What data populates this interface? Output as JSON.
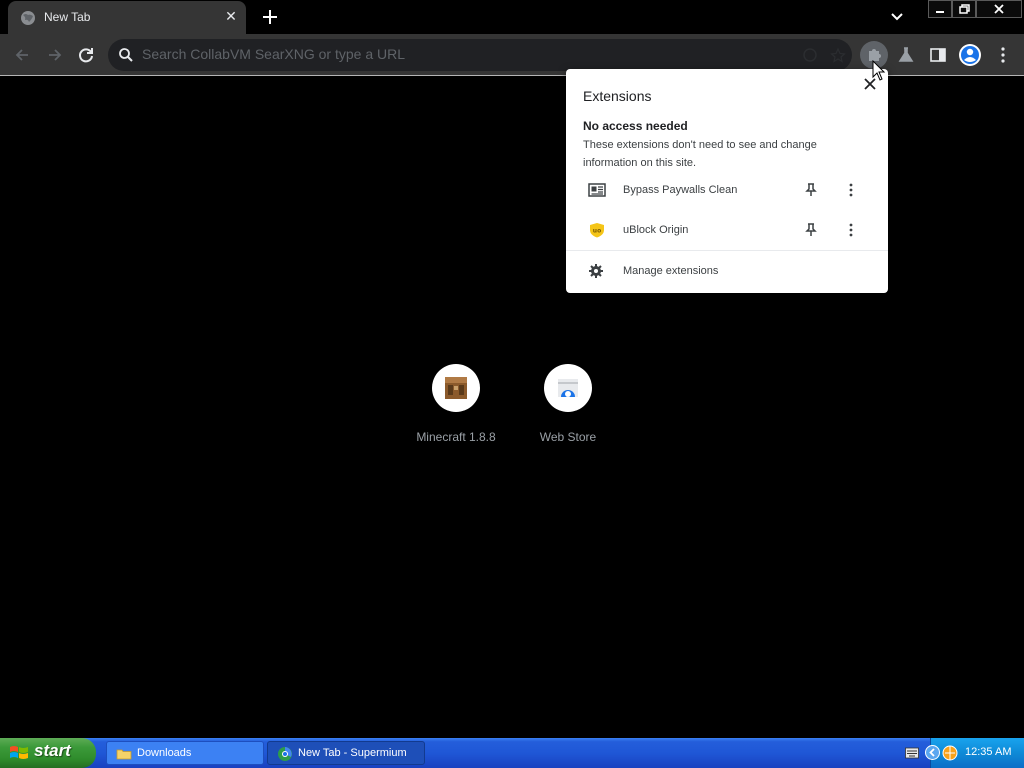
{
  "tab": {
    "title": "New Tab",
    "close": "✕"
  },
  "omnibox": {
    "placeholder": "Search CollabVM SearXNG or type a URL"
  },
  "extensions_popup": {
    "title": "Extensions",
    "section_title": "No access needed",
    "section_description": "These extensions don't need to see and change information on this site.",
    "items": [
      {
        "name": "Bypass Paywalls Clean",
        "icon": "newspaper-icon"
      },
      {
        "name": "uBlock Origin",
        "icon": "ublock-shield-icon",
        "color": "#f5c518"
      }
    ],
    "manage_label": "Manage extensions"
  },
  "shortcuts": [
    {
      "label": "Minecraft 1.8.8",
      "icon": "crafting-table-icon"
    },
    {
      "label": "Web Store",
      "icon": "web-store-icon"
    }
  ],
  "taskbar": {
    "start_label": "start",
    "tasks": [
      {
        "label": "Downloads",
        "icon": "folder-icon"
      },
      {
        "label": "New Tab - Supermium",
        "icon": "browser-icon"
      }
    ],
    "clock": "12:35 AM"
  },
  "colors": {
    "toolbar": "#353535",
    "omnibox": "#202124",
    "taskbar_blue": "#245edb",
    "start_green": "#3c9a3a",
    "tray_blue": "#0e8ad7"
  }
}
